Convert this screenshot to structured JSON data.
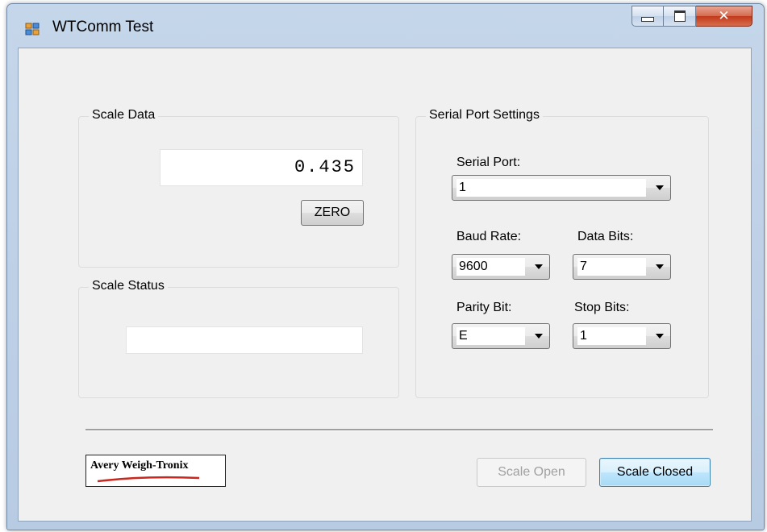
{
  "window": {
    "title": "WTComm Test",
    "controls": [
      "minimize-icon",
      "maximize-icon",
      "close-icon"
    ]
  },
  "scale_data": {
    "group_label": "Scale Data",
    "weight_value": "0.435",
    "zero_label": "ZERO"
  },
  "scale_status": {
    "group_label": "Scale Status",
    "status_value": ""
  },
  "serial_port_settings": {
    "group_label": "Serial Port Settings",
    "serial_port": {
      "label": "Serial Port:",
      "value": "1"
    },
    "baud_rate": {
      "label": "Baud Rate:",
      "value": "9600"
    },
    "data_bits": {
      "label": "Data Bits:",
      "value": "7"
    },
    "parity_bit": {
      "label": "Parity Bit:",
      "value": "E"
    },
    "stop_bits": {
      "label": "Stop Bits:",
      "value": "1"
    }
  },
  "footer": {
    "logo_text": "Avery Weigh-Tronix",
    "scale_open_label": "Scale Open",
    "scale_closed_label": "Scale Closed"
  },
  "colors": {
    "client_background": "#f0f0f0",
    "window_frame": "#c5d6ea",
    "logo_swoosh": "#c8281e",
    "focused_button_border": "#3c7fb1"
  }
}
